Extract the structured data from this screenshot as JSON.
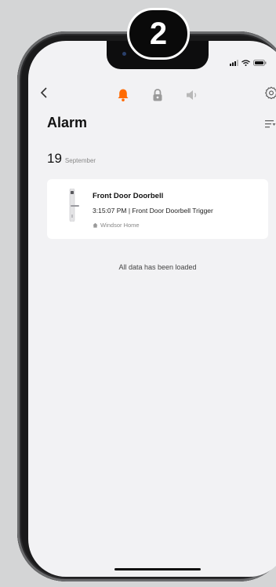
{
  "step_badge": "2",
  "header": {
    "tabs": [
      {
        "icon": "bell-icon",
        "active": true
      },
      {
        "icon": "lock-icon",
        "active": false
      },
      {
        "icon": "speaker-icon",
        "active": false
      }
    ],
    "accent_color": "#ff6a00"
  },
  "page": {
    "title": "Alarm"
  },
  "date": {
    "day": "19",
    "month": "September"
  },
  "alarms": [
    {
      "title": "Front Door Doorbell",
      "detail": "3:15:07 PM | Front Door Doorbell Trigger",
      "home": "Windsor Home"
    }
  ],
  "footer_message": "All data has been loaded"
}
